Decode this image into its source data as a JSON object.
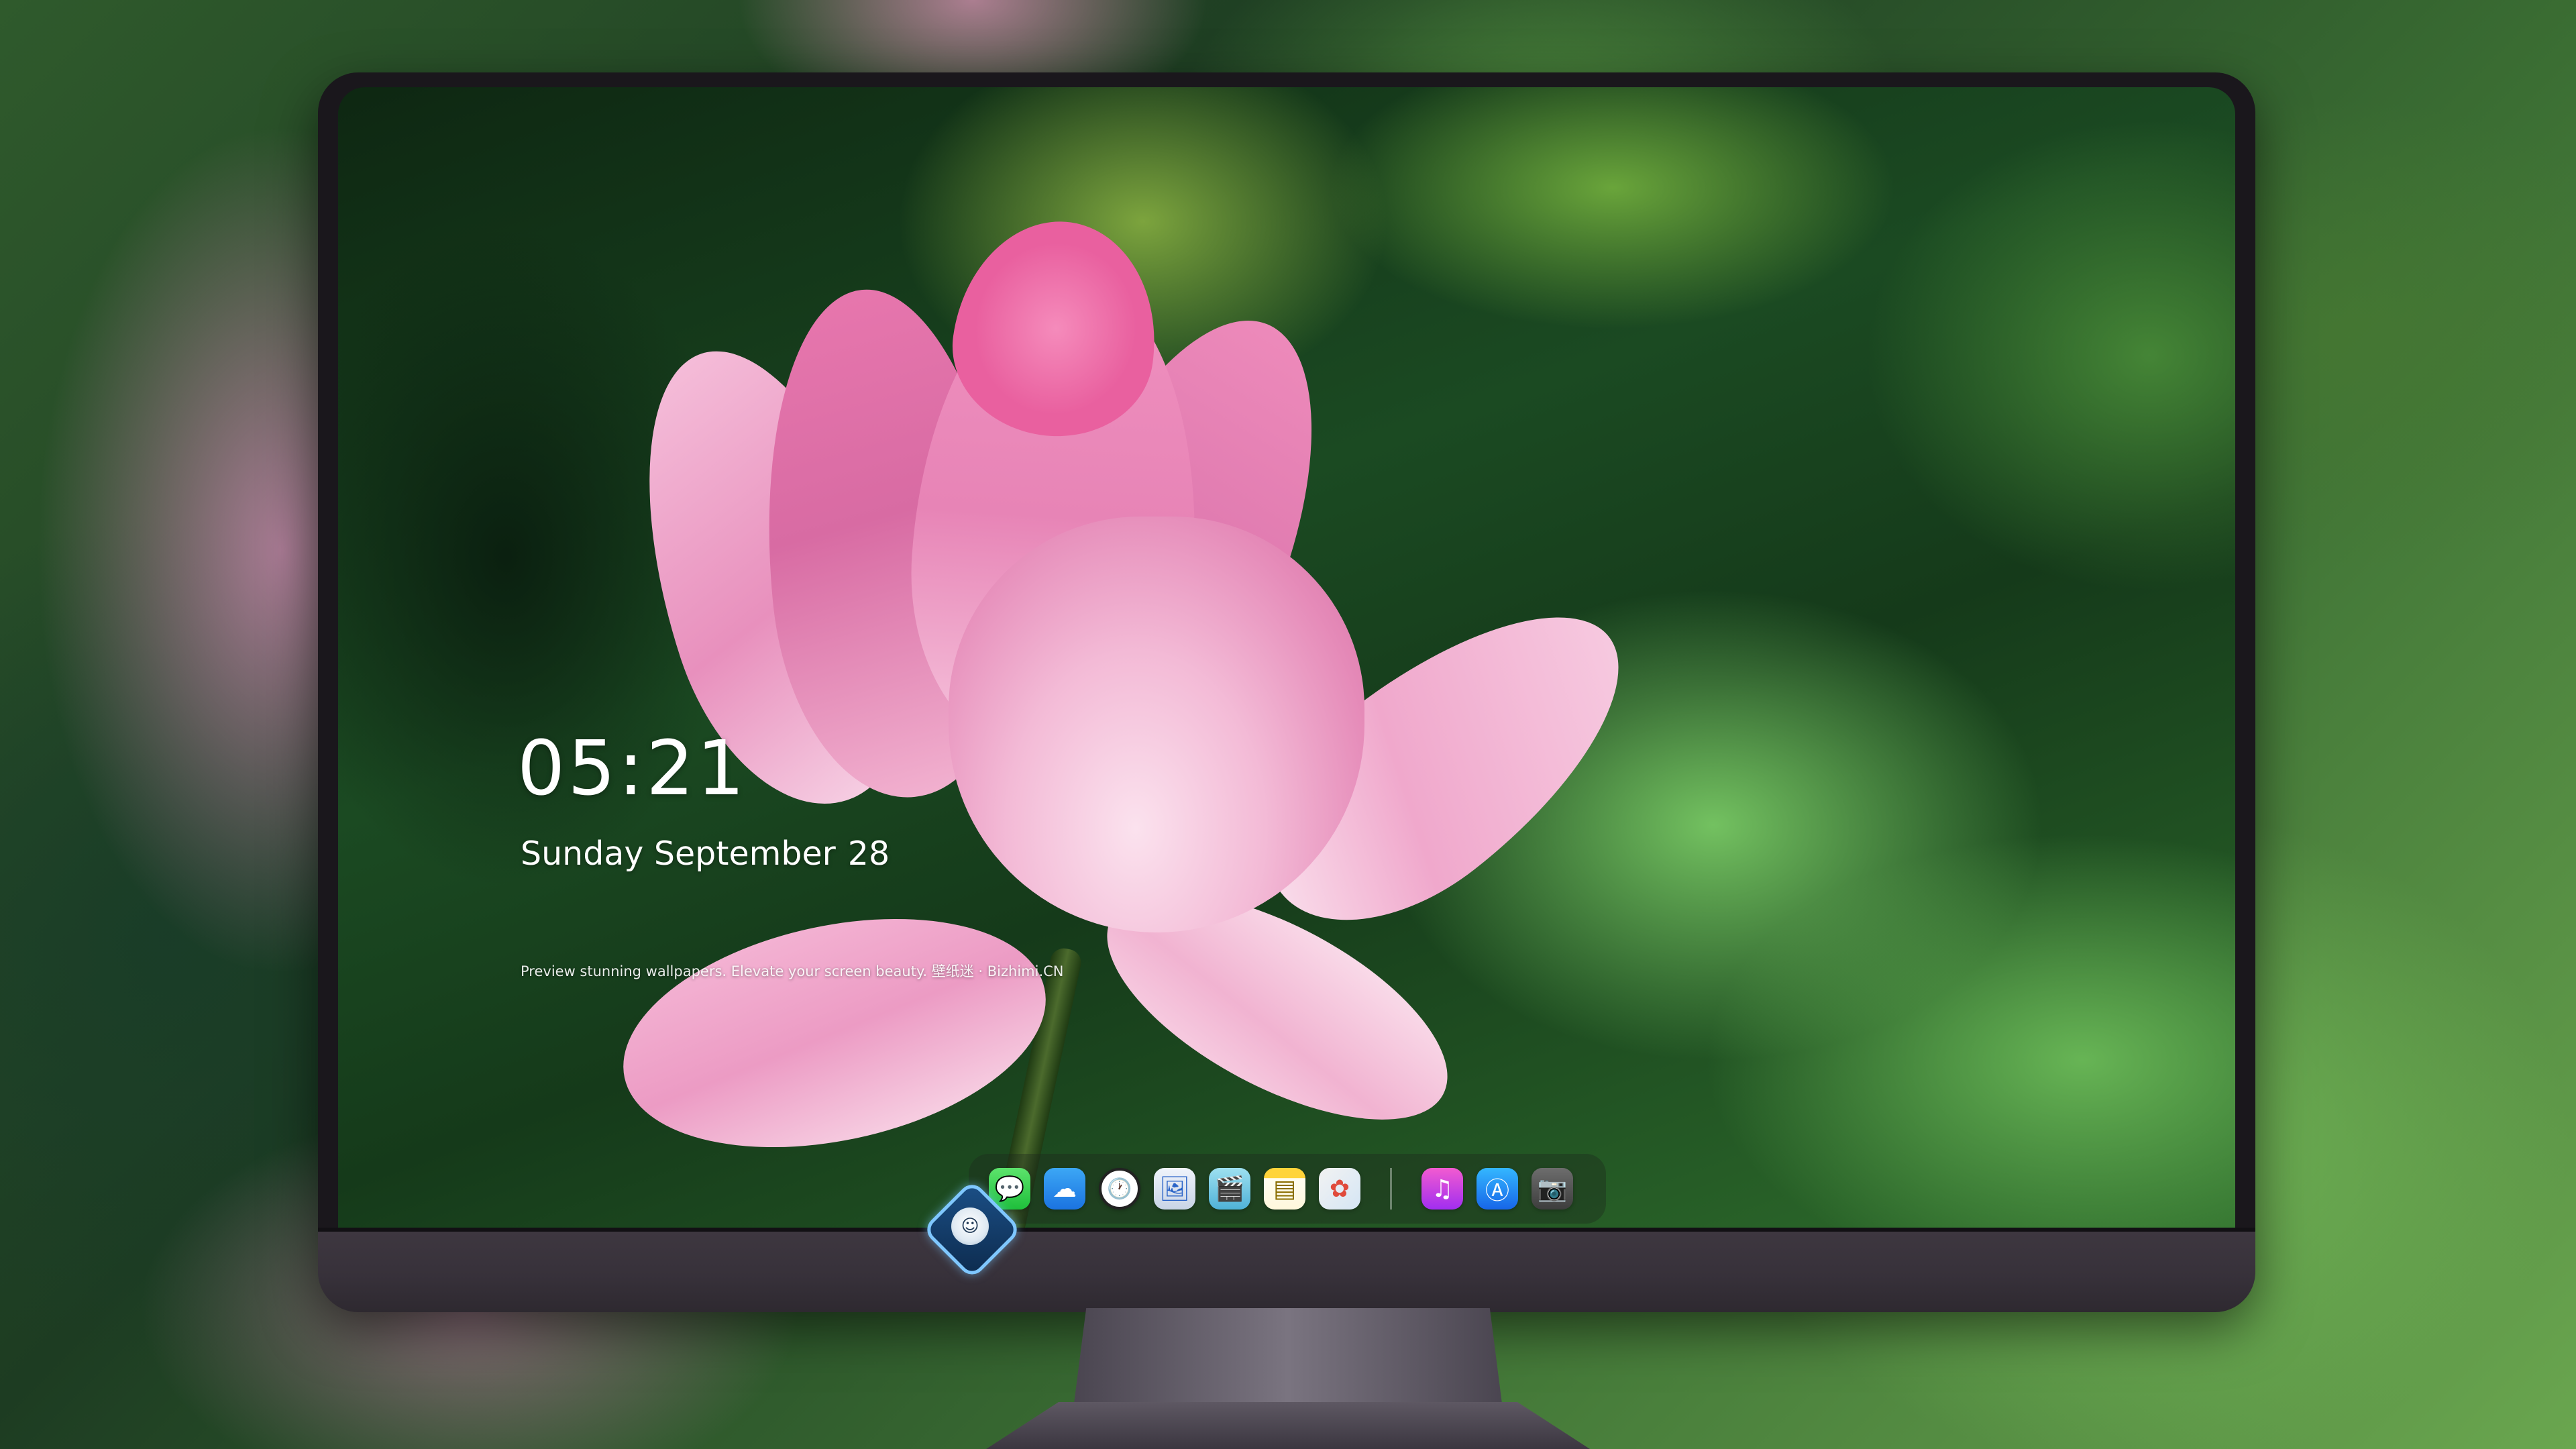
{
  "lock_screen": {
    "time": "05:21",
    "weekday_month": "Sunday September",
    "day": "28",
    "tagline": "Preview stunning wallpapers. Elevate your screen beauty. 壁纸迷 · Bizhimi.CN"
  },
  "dock": {
    "left_apps": [
      {
        "name": "messages-icon",
        "glyph": "💬"
      },
      {
        "name": "weather-icon",
        "glyph": "☁"
      },
      {
        "name": "clock-icon",
        "glyph": "🕐"
      },
      {
        "name": "preview-icon",
        "glyph": "🖼"
      },
      {
        "name": "clapper-icon",
        "glyph": "🎬"
      },
      {
        "name": "notes-icon",
        "glyph": "▤"
      },
      {
        "name": "photos-icon",
        "glyph": "✿"
      }
    ],
    "right_apps": [
      {
        "name": "music-icon",
        "glyph": "♫"
      },
      {
        "name": "app-store-icon",
        "glyph": "Ⓐ"
      },
      {
        "name": "camera-icon",
        "glyph": "📷"
      }
    ]
  },
  "colors": {
    "text": "#ffffff",
    "monitor_frame": "#1a171c",
    "chin": "#3e3740"
  }
}
